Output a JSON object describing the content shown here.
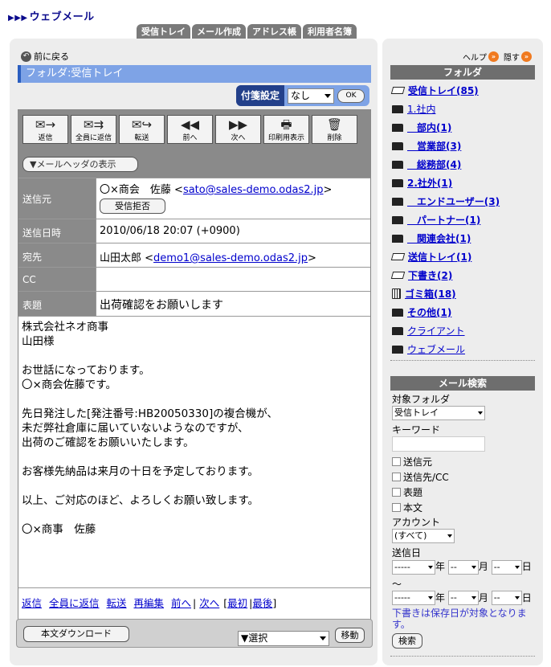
{
  "brand": {
    "arrows": "▶▶▶",
    "title": "ウェブメール"
  },
  "tabs": [
    "受信トレイ",
    "メール作成",
    "アドレス帳",
    "利用者名簿"
  ],
  "nav": {
    "back": "前に戻る",
    "help": "ヘルプ",
    "close": "隠す"
  },
  "folder_title": "フォルダ:受信トレイ",
  "fusen": {
    "label": "付箋設定",
    "value": "なし",
    "ok": "OK"
  },
  "toolbar": [
    {
      "label": "返信",
      "icon": "✉→"
    },
    {
      "label": "全員に返信",
      "icon": "✉⇉"
    },
    {
      "label": "転送",
      "icon": "✉↪"
    },
    {
      "label": "前へ",
      "icon": "◀◀"
    },
    {
      "label": "次へ",
      "icon": "▶▶"
    },
    {
      "label": "印刷用表示",
      "icon": "🖶"
    },
    {
      "label": "削除",
      "icon": "🗑"
    }
  ],
  "header_toggle": "▼メールヘッダの表示",
  "headers": {
    "from_label": "送信元",
    "from_name": "〇×商会　佐藤 ",
    "from_email": "sato@sales-demo.odas2.jp",
    "reject": "受信拒否",
    "date_label": "送信日時",
    "date_value": "2010/06/18 20:07 (+0900)",
    "to_label": "宛先",
    "to_name": "山田太郎 ",
    "to_email": "demo1@sales-demo.odas2.jp",
    "cc_label": "CC",
    "cc_value": "",
    "subject_label": "表題",
    "subject_value": "出荷確認をお願いします"
  },
  "body": "株式会社ネオ商事\n山田様\n\nお世話になっております。\n〇×商会佐藤です。\n\n先日発注した[発注番号:HB20050330]の複合機が、\n未だ弊社倉庫に届いていないようなのですが、\n出荷のご確認をお願いいたします。\n\nお客様先納品は来月の十日を予定しております。\n\n以上、ご対応のほど、よろしくお願い致します。\n\n〇×商事　佐藤",
  "footer_links": {
    "reply": "返信",
    "reply_all": "全員に返信",
    "forward": "転送",
    "reedit": "再編集",
    "prev": "前へ",
    "next": "次へ",
    "first": "最初",
    "last": "最後"
  },
  "bottom": {
    "download": "本文ダウンロード",
    "select": "▼選択",
    "move": "移動"
  },
  "sidebar": {
    "folder_head": "フォルダ",
    "folders": [
      {
        "label": "受信トレイ(85)",
        "icon": "tray",
        "bold": true,
        "indent": 0
      },
      {
        "label": "1.社内",
        "icon": "folder",
        "bold": false,
        "indent": 0
      },
      {
        "label": "　部内(1)",
        "icon": "folder",
        "bold": true,
        "indent": 0
      },
      {
        "label": "　営業部(3)",
        "icon": "folder",
        "bold": true,
        "indent": 0
      },
      {
        "label": "　総務部(4)",
        "icon": "folder",
        "bold": true,
        "indent": 0
      },
      {
        "label": "2.社外(1)",
        "icon": "folder",
        "bold": true,
        "indent": 0
      },
      {
        "label": "　エンドユーザー(3)",
        "icon": "folder",
        "bold": true,
        "indent": 0
      },
      {
        "label": "　パートナー(1)",
        "icon": "folder",
        "bold": true,
        "indent": 0
      },
      {
        "label": "　関連会社(1)",
        "icon": "folder",
        "bold": true,
        "indent": 0
      },
      {
        "label": "送信トレイ(1)",
        "icon": "tray",
        "bold": true,
        "indent": 0
      },
      {
        "label": "下書き(2)",
        "icon": "tray",
        "bold": true,
        "indent": 0
      },
      {
        "label": "ゴミ箱(18)",
        "icon": "trash",
        "bold": true,
        "indent": 0
      },
      {
        "label": "その他(1)",
        "icon": "folder",
        "bold": true,
        "indent": 0
      },
      {
        "label": "クライアント",
        "icon": "folder",
        "bold": false,
        "indent": 0
      },
      {
        "label": "ウェブメール",
        "icon": "folder",
        "bold": false,
        "indent": 0
      }
    ],
    "search_head": "メール検索",
    "target_label": "対象フォルダ",
    "target_value": "受信トレイ",
    "keyword_label": "キーワード",
    "checks": [
      "送信元",
      "送信先/CC",
      "表題",
      "本文"
    ],
    "account_label": "アカウント",
    "account_value": "(すべて)",
    "date_label": "送信日",
    "date_from": {
      "y": "-----",
      "y_unit": "年",
      "m": "--",
      "m_unit": "月",
      "d": "--",
      "d_unit": "日"
    },
    "tilde": "〜",
    "date_to": {
      "y": "-----",
      "y_unit": "年",
      "m": "--",
      "m_unit": "月",
      "d": "--",
      "d_unit": "日"
    },
    "note": "下書きは保存日が対象となります。",
    "search_btn": "検索"
  }
}
